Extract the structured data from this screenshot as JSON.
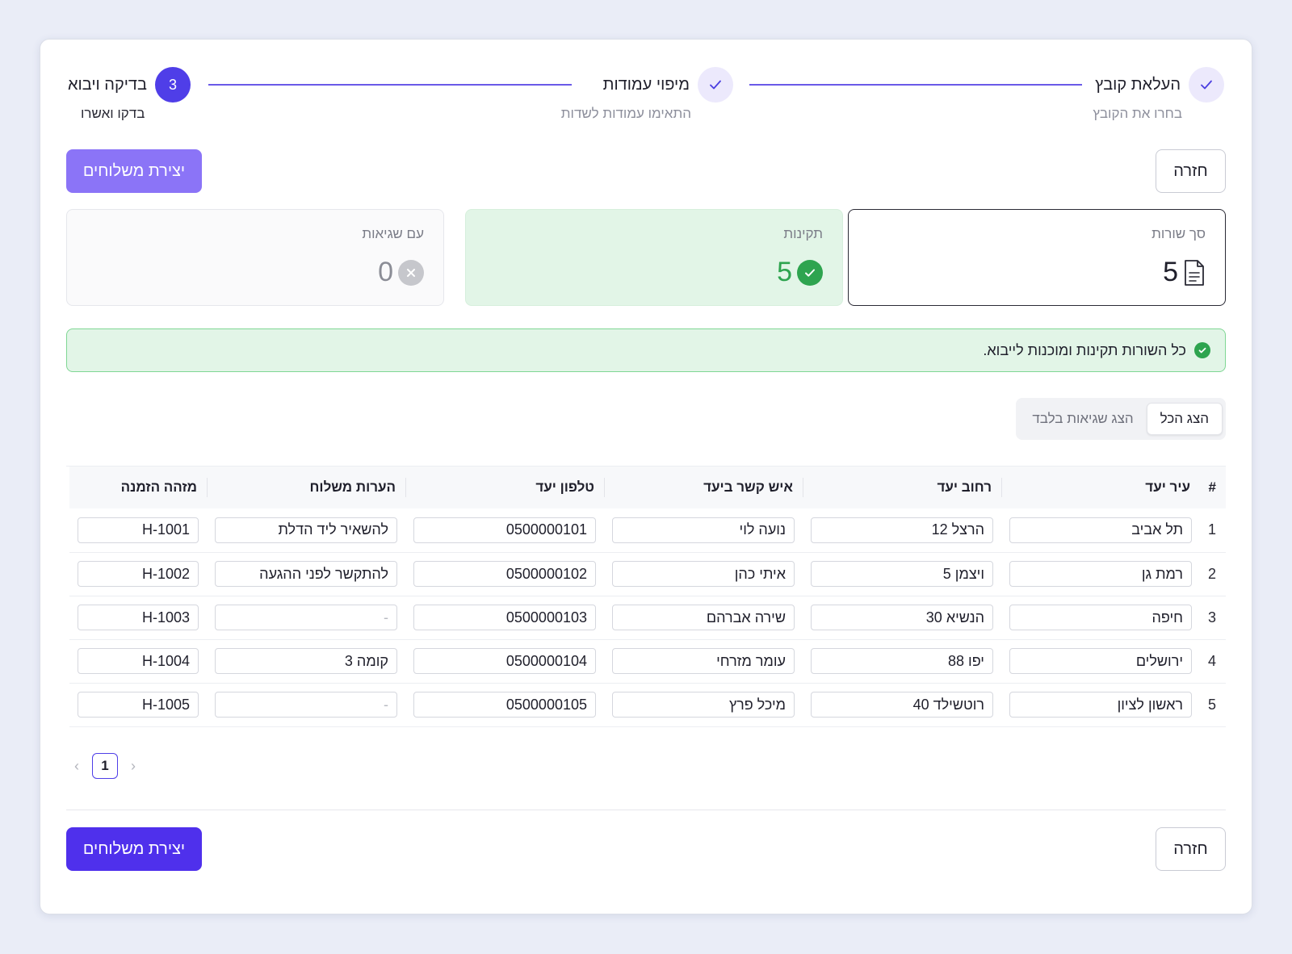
{
  "stepper": {
    "steps": [
      {
        "number": "",
        "title": "העלאת קובץ",
        "subtitle": "בחרו את הקובץ",
        "state": "done"
      },
      {
        "number": "",
        "title": "מיפוי עמודות",
        "subtitle": "התאימו עמודות לשדות",
        "state": "done"
      },
      {
        "number": "3",
        "title": "בדיקה ויבוא",
        "subtitle": "בדקו ואשרו",
        "state": "active"
      }
    ]
  },
  "actions": {
    "back_label": "חזרה",
    "create_label": "יצירת משלוחים"
  },
  "stats": {
    "total": {
      "label": "סך שורות",
      "value": "5",
      "icon": "document-icon"
    },
    "valid": {
      "label": "תקינות",
      "value": "5",
      "icon": "check-circle-icon"
    },
    "errors": {
      "label": "עם שגיאות",
      "value": "0",
      "icon": "x-circle-icon"
    }
  },
  "alert": {
    "text": "כל השורות תקינות ומוכנות לייבוא.",
    "icon": "check-circle-icon"
  },
  "filter": {
    "options": [
      "הצג הכל",
      "הצג שגיאות בלבד"
    ],
    "selected": "הצג הכל"
  },
  "table": {
    "headers": [
      "#",
      "עיר יעד",
      "רחוב יעד",
      "איש קשר ביעד",
      "טלפון יעד",
      "הערות משלוח",
      "מזהה הזמנה"
    ],
    "rows": [
      {
        "index": "1",
        "city": "תל אביב",
        "street": "הרצל 12",
        "contact": "נועה לוי",
        "phone": "0500000101",
        "notes": "להשאיר ליד הדלת",
        "order_id": "H-1001"
      },
      {
        "index": "2",
        "city": "רמת גן",
        "street": "ויצמן 5",
        "contact": "איתי כהן",
        "phone": "0500000102",
        "notes": "להתקשר לפני ההגעה",
        "order_id": "H-1002"
      },
      {
        "index": "3",
        "city": "חיפה",
        "street": "הנשיא 30",
        "contact": "שירה אברהם",
        "phone": "0500000103",
        "notes": "-",
        "order_id": "H-1003"
      },
      {
        "index": "4",
        "city": "ירושלים",
        "street": "יפו 88",
        "contact": "עומר מזרחי",
        "phone": "0500000104",
        "notes": "קומה 3",
        "order_id": "H-1004"
      },
      {
        "index": "5",
        "city": "ראשון לציון",
        "street": "רוטשילד 40",
        "contact": "מיכל פרץ",
        "phone": "0500000105",
        "notes": "-",
        "order_id": "H-1005"
      }
    ]
  },
  "pagination": {
    "current_page": "1",
    "prev_icon": "chevron-left-icon",
    "next_icon": "chevron-right-icon"
  },
  "colors": {
    "accent": "#4f3ee8",
    "primary_button_light": "#8b74f7",
    "primary_button_dark": "#4f30ec",
    "success": "#2ea44f",
    "success_bg": "#e2f5e7"
  }
}
